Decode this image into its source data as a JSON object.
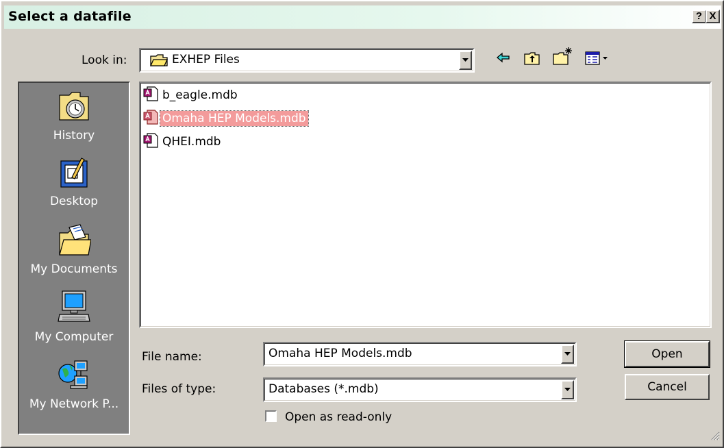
{
  "window": {
    "title": "Select a datafile",
    "help_label": "?",
    "close_label": "X"
  },
  "lookin": {
    "label": "Look in:",
    "value": "EXHEP Files"
  },
  "toolbar": {
    "icons": [
      "back-icon",
      "up-folder-icon",
      "new-folder-icon",
      "view-menu-icon"
    ]
  },
  "places": [
    {
      "label": "History",
      "icon": "history-icon"
    },
    {
      "label": "Desktop",
      "icon": "desktop-icon"
    },
    {
      "label": "My Documents",
      "icon": "my-documents-icon"
    },
    {
      "label": "My Computer",
      "icon": "my-computer-icon"
    },
    {
      "label": "My Network P...",
      "icon": "my-network-places-icon"
    }
  ],
  "files": [
    {
      "name": "b_eagle.mdb",
      "selected": false
    },
    {
      "name": "Omaha HEP Models.mdb",
      "selected": true
    },
    {
      "name": "QHEI.mdb",
      "selected": false
    }
  ],
  "filename": {
    "label": "File name:",
    "value": "Omaha HEP Models.mdb"
  },
  "filetype": {
    "label": "Files of type:",
    "value": "Databases (*.mdb)"
  },
  "readonly": {
    "label": "Open as read-only",
    "checked": false
  },
  "buttons": {
    "open": "Open",
    "cancel": "Cancel"
  },
  "colors": {
    "selection": "#f39b9b",
    "sidebar": "#808080",
    "face": "#d4d0c8"
  }
}
